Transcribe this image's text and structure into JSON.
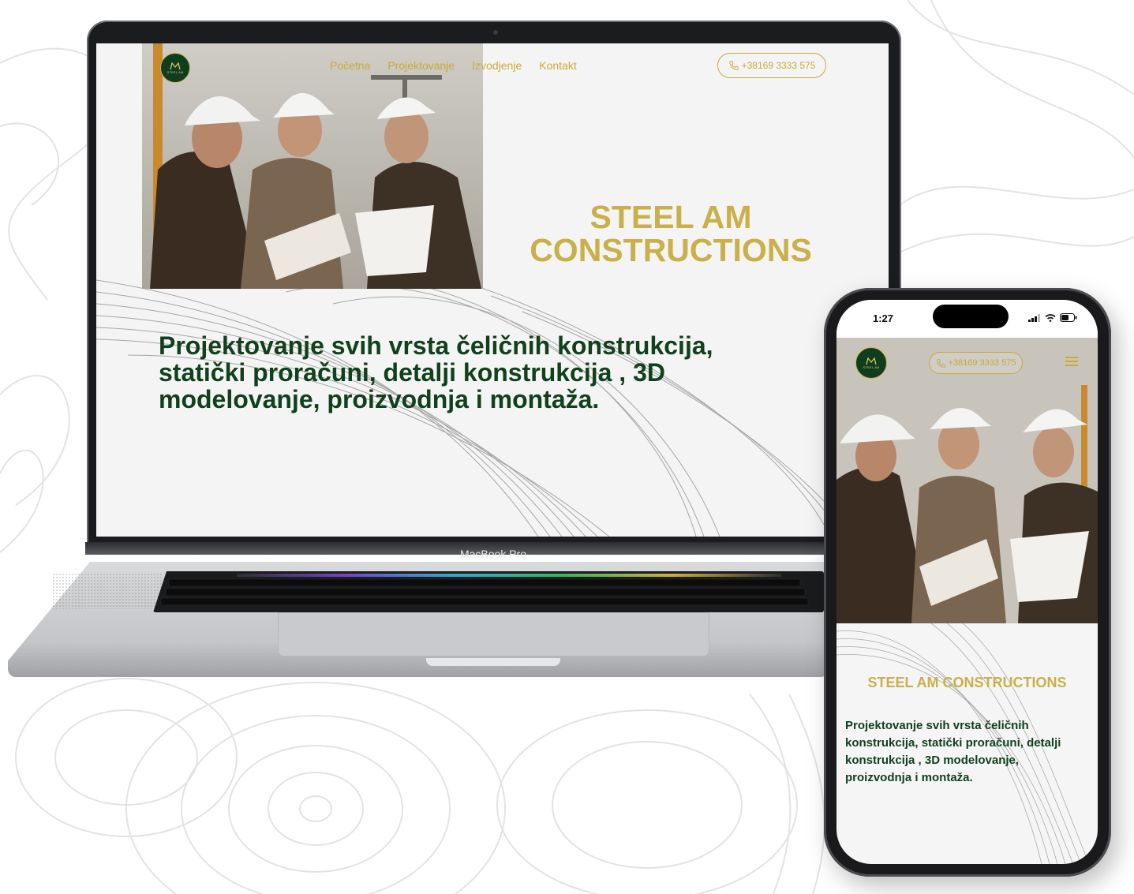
{
  "brand": {
    "logo_text_top": "STEEL AM",
    "logo_text_bottom": "CONSTRUCTIONS",
    "gold": "#c9b04a",
    "dark_green": "#11401d"
  },
  "laptop": {
    "device_label": "MacBook Pro",
    "nav": {
      "items": [
        "Početna",
        "Projektovanje",
        "Izvodjenje",
        "Kontakt"
      ]
    },
    "phone_button": "+38169 3333 575",
    "hero": {
      "title_line1": "STEEL AM",
      "title_line2": "CONSTRUCTIONS",
      "subtitle": "Projektovanje svih vrsta čeličnih konstrukcija, statički proračuni, detalji konstrukcija , 3D modelovanje, proizvodnja i montaža."
    }
  },
  "phone": {
    "status_time": "1:27",
    "phone_button": "+38169 3333 575",
    "title": "STEEL AM CONSTRUCTIONS",
    "subtitle": "Projektovanje svih vrsta čeličnih konstrukcija, statički proračuni, detalji konstrukcija , 3D modelovanje, proizvodnja i montaža.",
    "menu_icon": "hamburger-icon"
  }
}
